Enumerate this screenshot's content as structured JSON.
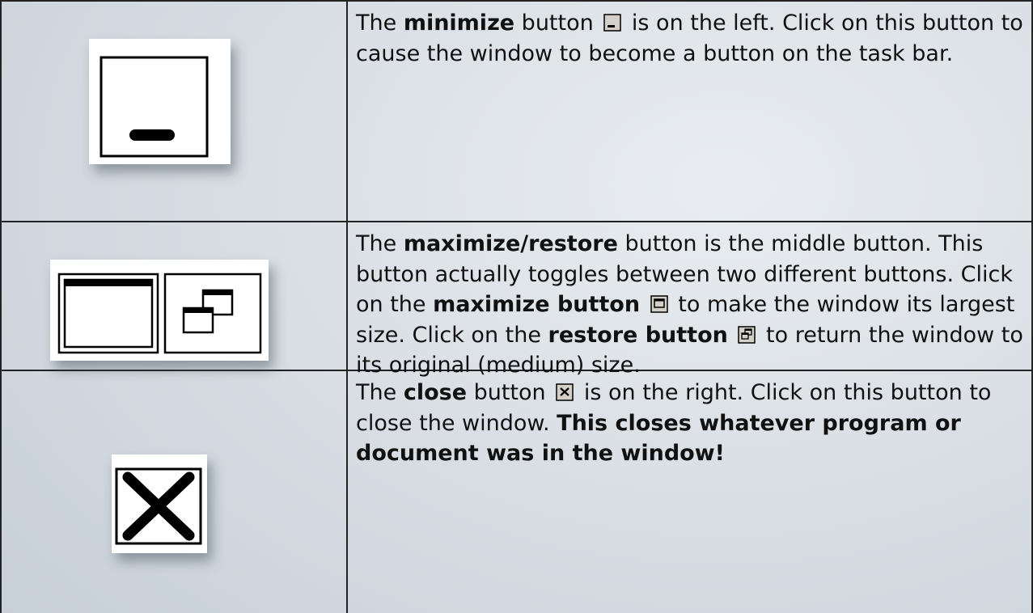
{
  "rows": [
    {
      "parts": [
        {
          "t": "The ",
          "b": false
        },
        {
          "t": "minimize",
          "b": true
        },
        {
          "t": " button ",
          "b": false
        },
        {
          "icon": "minimize-icon"
        },
        {
          "t": " is on the left. Click on this button to cause the window to become a button on the task bar.",
          "b": false
        }
      ]
    },
    {
      "parts": [
        {
          "t": "The ",
          "b": false
        },
        {
          "t": "maximize/restore",
          "b": true
        },
        {
          "t": " button is the middle button. This button actually toggles between two different buttons.  Click on the ",
          "b": false
        },
        {
          "t": "maximize button",
          "b": true
        },
        {
          "t": " ",
          "b": false
        },
        {
          "icon": "maximize-icon"
        },
        {
          "t": " to make the window its largest size.  Click on the ",
          "b": false
        },
        {
          "t": "restore button",
          "b": true
        },
        {
          "t": " ",
          "b": false
        },
        {
          "icon": "restore-icon"
        },
        {
          "t": " to return the window to its original (medium) size.",
          "b": false
        }
      ]
    },
    {
      "parts": [
        {
          "t": "The ",
          "b": false
        },
        {
          "t": "close",
          "b": true
        },
        {
          "t": " button ",
          "b": false
        },
        {
          "icon": "close-icon"
        },
        {
          "t": " is on the right.  Click on this button to close the window.  ",
          "b": false
        },
        {
          "t": "This closes whatever program or document was in the window!",
          "b": true
        }
      ]
    }
  ],
  "illustrations": [
    "minimize-icon",
    "maximize-icon",
    "restore-icon",
    "close-icon"
  ]
}
